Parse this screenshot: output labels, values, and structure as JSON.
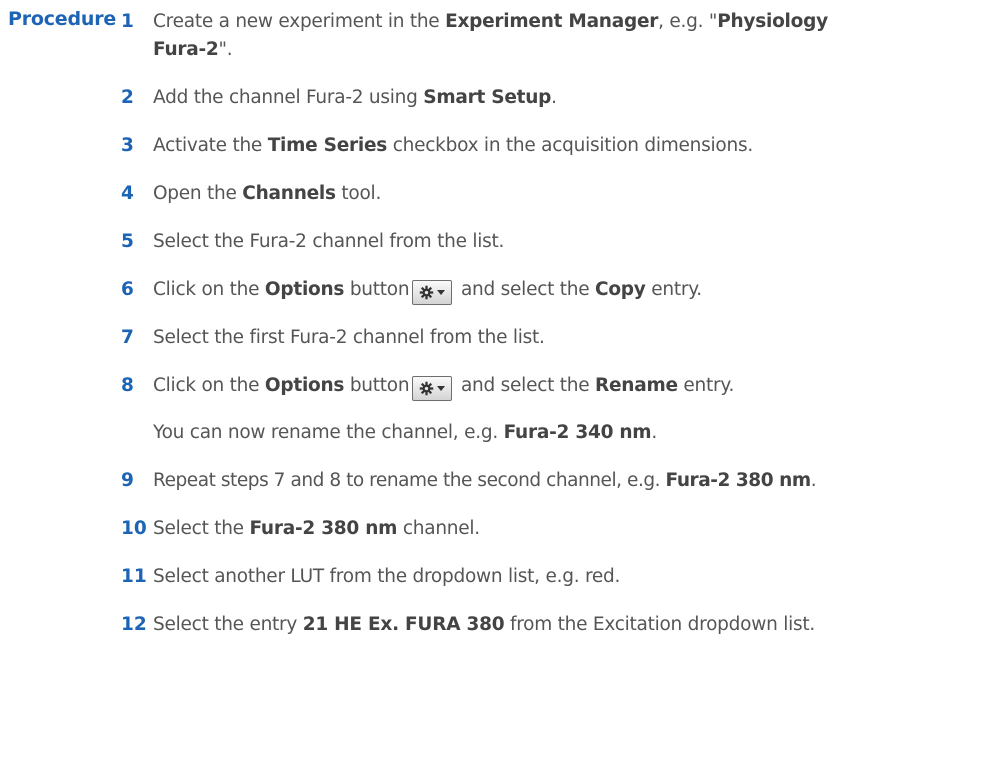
{
  "section_label": "Procedure",
  "steps": [
    {
      "num": "1",
      "p1": "Create a new experiment in the ",
      "b1": "Experiment Manager",
      "p2": ", e.g. \"",
      "b2": "Physiology",
      "b3": "Fura-2",
      "p3": "\"."
    },
    {
      "num": "2",
      "p1": "Add the channel Fura-2 using ",
      "b1": "Smart Setup",
      "p2": "."
    },
    {
      "num": "3",
      "p1": "Activate the ",
      "b1": "Time Series",
      "p2": " checkbox in the acquisition dimensions."
    },
    {
      "num": "4",
      "p1": "Open the ",
      "b1": "Channels",
      "p2": " tool."
    },
    {
      "num": "5",
      "p1": "Select the Fura-2 channel from the list."
    },
    {
      "num": "6",
      "p1": "Click on the ",
      "b1": "Options",
      "p2": " button",
      "p3": " and select the ",
      "b2": "Copy",
      "p4": " entry."
    },
    {
      "num": "7",
      "p1": "Select the first Fura-2 channel from the list."
    },
    {
      "num": "8",
      "p1": "Click on the ",
      "b1": "Options",
      "p2": " button",
      "p3": " and select the ",
      "b2": "Rename",
      "p4": " entry.",
      "result_p1": "You can now rename the channel, e.g. ",
      "result_b1": "Fura-2 340 nm",
      "result_p2": "."
    },
    {
      "num": "9",
      "p1": "Repeat steps 7 and 8 to rename the second channel, e.g. ",
      "b1": "Fura-2 380 nm",
      "p2": "."
    },
    {
      "num": "10",
      "p1": "Select the ",
      "b1": "Fura-2 380 nm",
      "p2": " channel."
    },
    {
      "num": "11",
      "p1": "Select another LUT from the dropdown list, e.g. red."
    },
    {
      "num": "12",
      "p1": "Select the entry ",
      "b1": "21 HE Ex. FURA 380",
      "p2": " from the Excitation dropdown list."
    }
  ],
  "icons": {
    "options_button_icon": "gear-icon",
    "options_button_arrow": "caret-down-icon"
  },
  "colors": {
    "accent_blue": "#1e64b4",
    "body_text": "#555555",
    "bold_text": "#444444"
  }
}
